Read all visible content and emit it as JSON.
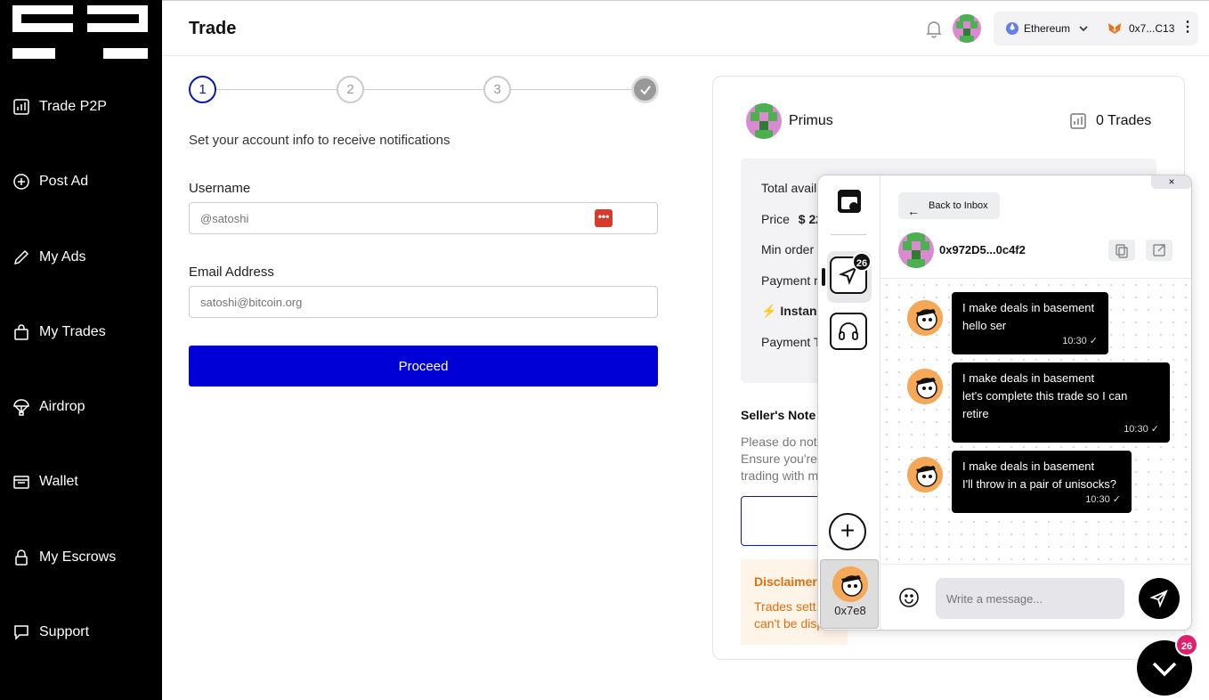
{
  "sidebar": {
    "items": [
      {
        "label": "Trade P2P",
        "icon": "chart-icon"
      },
      {
        "label": "Post Ad",
        "icon": "plus-circle-icon"
      },
      {
        "label": "My Ads",
        "icon": "pencil-icon"
      },
      {
        "label": "My Trades",
        "icon": "bag-icon"
      },
      {
        "label": "Airdrop",
        "icon": "parachute-icon"
      },
      {
        "label": "Wallet",
        "icon": "wallet-icon"
      },
      {
        "label": "My Escrows",
        "icon": "lock-icon"
      },
      {
        "label": "Support",
        "icon": "chat-icon"
      }
    ]
  },
  "header": {
    "title": "Trade",
    "network": "Ethereum",
    "wallet": "0x7...C13"
  },
  "steps": [
    "1",
    "2",
    "3"
  ],
  "form": {
    "subtitle": "Set your account info to receive notifications",
    "username_label": "Username",
    "username_placeholder": "@satoshi",
    "email_label": "Email Address",
    "email_placeholder": "satoshi@bitcoin.org",
    "proceed_label": "Proceed"
  },
  "offer": {
    "seller_name": "Primus",
    "trades": "0 Trades",
    "rows": [
      "Total avail",
      "Price",
      "Min order",
      "Payment m",
      "Instan",
      "Payment T"
    ],
    "price_value": "$ 22",
    "notes_title": "Seller's Note",
    "notes_lines": [
      "Please do not",
      "Ensure you're",
      "trading with m"
    ],
    "disclaimer_title": "Disclaimer",
    "disclaimer_lines": [
      "Trades sett",
      "can't be disp"
    ]
  },
  "chat": {
    "close": "×",
    "badge_count": "26",
    "contact_label": "0x7e8",
    "back_label": "Back to Inbox",
    "peer_address": "0x972D5...0c4f2",
    "messages": [
      {
        "lines": [
          "I make deals in basement",
          "hello ser"
        ],
        "time": "10:30"
      },
      {
        "lines": [
          "I make deals in basement",
          "let's complete this trade so I can",
          "retire"
        ],
        "time": "10:30"
      },
      {
        "lines": [
          "I make deals in basement",
          "I'll throw in a pair of unisocks?"
        ],
        "time": "10:30"
      }
    ],
    "input_placeholder": "Write a message...",
    "fab_badge": "26"
  },
  "colors": {
    "primary": "#0000d6",
    "step_active": "#0a1aa8",
    "disclaimer": "#e07010",
    "badge_pink": "#e0206a"
  }
}
